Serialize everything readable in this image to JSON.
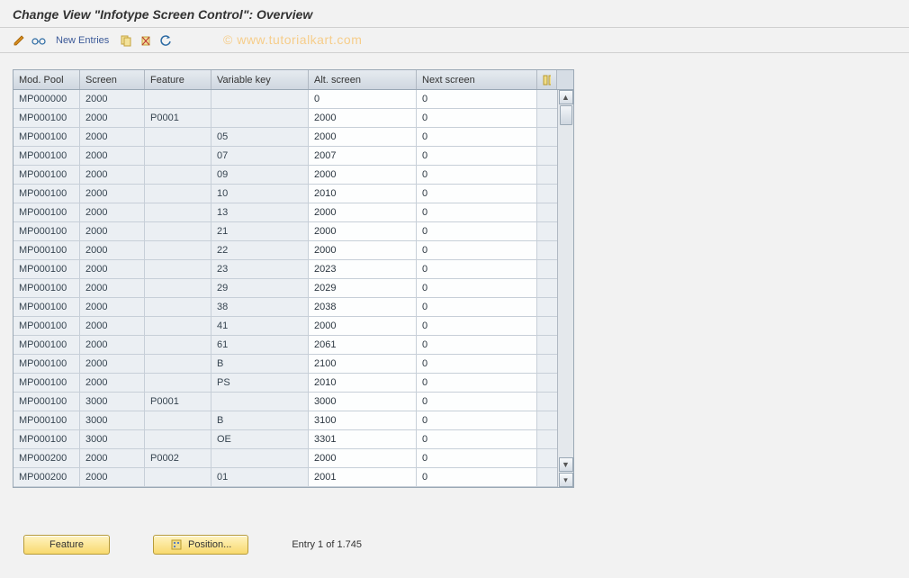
{
  "header": {
    "title": "Change View \"Infotype Screen Control\": Overview"
  },
  "watermark": "©  www.tutorialkart.com",
  "toolbar": {
    "new_entries_label": "New Entries"
  },
  "grid": {
    "columns": {
      "modpool": "Mod. Pool",
      "screen": "Screen",
      "feature": "Feature",
      "varkey": "Variable key",
      "altscreen": "Alt. screen",
      "nextscreen": "Next screen"
    },
    "rows": [
      {
        "modpool": "MP000000",
        "screen": "2000",
        "feature": "",
        "varkey": "",
        "altscreen": "0",
        "nextscreen": "0"
      },
      {
        "modpool": "MP000100",
        "screen": "2000",
        "feature": "P0001",
        "varkey": "",
        "altscreen": "2000",
        "nextscreen": "0"
      },
      {
        "modpool": "MP000100",
        "screen": "2000",
        "feature": "",
        "varkey": "05",
        "altscreen": "2000",
        "nextscreen": "0"
      },
      {
        "modpool": "MP000100",
        "screen": "2000",
        "feature": "",
        "varkey": "07",
        "altscreen": "2007",
        "nextscreen": "0"
      },
      {
        "modpool": "MP000100",
        "screen": "2000",
        "feature": "",
        "varkey": "09",
        "altscreen": "2000",
        "nextscreen": "0"
      },
      {
        "modpool": "MP000100",
        "screen": "2000",
        "feature": "",
        "varkey": "10",
        "altscreen": "2010",
        "nextscreen": "0"
      },
      {
        "modpool": "MP000100",
        "screen": "2000",
        "feature": "",
        "varkey": "13",
        "altscreen": "2000",
        "nextscreen": "0"
      },
      {
        "modpool": "MP000100",
        "screen": "2000",
        "feature": "",
        "varkey": "21",
        "altscreen": "2000",
        "nextscreen": "0"
      },
      {
        "modpool": "MP000100",
        "screen": "2000",
        "feature": "",
        "varkey": "22",
        "altscreen": "2000",
        "nextscreen": "0"
      },
      {
        "modpool": "MP000100",
        "screen": "2000",
        "feature": "",
        "varkey": "23",
        "altscreen": "2023",
        "nextscreen": "0"
      },
      {
        "modpool": "MP000100",
        "screen": "2000",
        "feature": "",
        "varkey": "29",
        "altscreen": "2029",
        "nextscreen": "0"
      },
      {
        "modpool": "MP000100",
        "screen": "2000",
        "feature": "",
        "varkey": "38",
        "altscreen": "2038",
        "nextscreen": "0"
      },
      {
        "modpool": "MP000100",
        "screen": "2000",
        "feature": "",
        "varkey": "41",
        "altscreen": "2000",
        "nextscreen": "0"
      },
      {
        "modpool": "MP000100",
        "screen": "2000",
        "feature": "",
        "varkey": "61",
        "altscreen": "2061",
        "nextscreen": "0"
      },
      {
        "modpool": "MP000100",
        "screen": "2000",
        "feature": "",
        "varkey": "B",
        "altscreen": "2100",
        "nextscreen": "0"
      },
      {
        "modpool": "MP000100",
        "screen": "2000",
        "feature": "",
        "varkey": "PS",
        "altscreen": "2010",
        "nextscreen": "0"
      },
      {
        "modpool": "MP000100",
        "screen": "3000",
        "feature": "P0001",
        "varkey": "",
        "altscreen": "3000",
        "nextscreen": "0"
      },
      {
        "modpool": "MP000100",
        "screen": "3000",
        "feature": "",
        "varkey": "B",
        "altscreen": "3100",
        "nextscreen": "0"
      },
      {
        "modpool": "MP000100",
        "screen": "3000",
        "feature": "",
        "varkey": "OE",
        "altscreen": "3301",
        "nextscreen": "0"
      },
      {
        "modpool": "MP000200",
        "screen": "2000",
        "feature": "P0002",
        "varkey": "",
        "altscreen": "2000",
        "nextscreen": "0"
      },
      {
        "modpool": "MP000200",
        "screen": "2000",
        "feature": "",
        "varkey": "01",
        "altscreen": "2001",
        "nextscreen": "0"
      }
    ]
  },
  "footer": {
    "feature_button": "Feature",
    "position_button": "Position...",
    "entry_label": "Entry 1 of 1.745"
  }
}
